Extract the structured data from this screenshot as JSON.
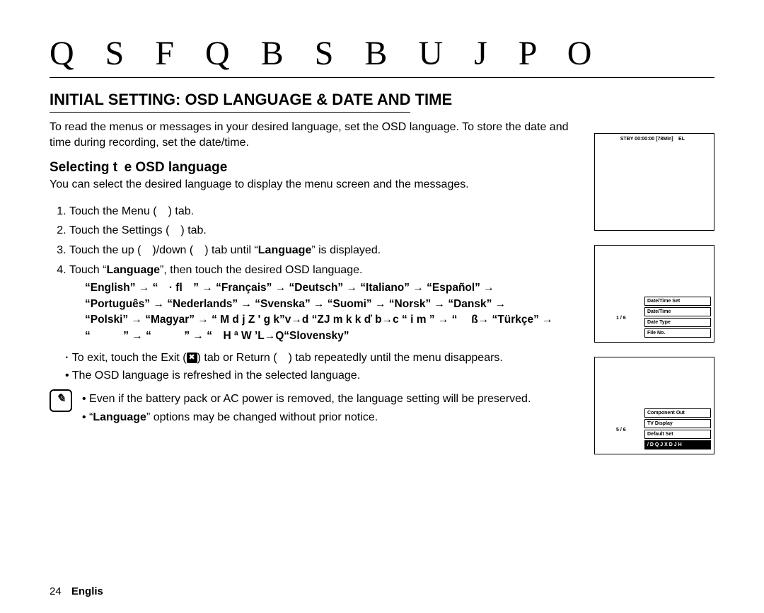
{
  "chapter_title": "Q S F Q B S B U J P O",
  "heading": "INITIAL SETTING: OSD LANGUAGE & DATE AND TIME",
  "intro": "To read the menus or messages in your desired language, set the OSD language. To store the date and time during recording, set the date/time.",
  "subheading": "Selecting t e OSD language",
  "subintro": "You can select the desired language to display the menu screen and the messages.",
  "steps": {
    "s1": "Touch the Menu (  ) tab.",
    "s2": "Touch the Settings (  ) tab.",
    "s3_pre": "Touch the up (  )/down (  ) tab until “",
    "s3_bold": "Language",
    "s3_post": "” is displayed.",
    "s4_pre": "Touch “",
    "s4_bold": "Language",
    "s4_post": "”, then touch the desired OSD language."
  },
  "lang_lines": {
    "l1": "“English” → “ · fl ” → “Français” → “Deutsch” → “Italiano” → “Español” →",
    "l2": "“Português” → “Nederlands” → “Svenska” → “Suomi” → “Norsk” → “Dansk” →",
    "l3": "“Polski” → “Magyar” → “ M d j Z ' g k”v→d “ZJ m k k ď b→c “ i m ” → “  ß→ “Türkçe” →",
    "l4": "“   ” → “   ” → “ H ª W ’L→Q“Slovensky”"
  },
  "bullets": {
    "exit_pre": "To exit, touch the Exit (",
    "exit_mid": ") tab or Return (  ) tab repeatedly until the menu disappears.",
    "exit_icon": "✖",
    "refresh": "The OSD language is refreshed in the selected language.",
    "preserve": "Even if the battery pack or AC power is removed, the language setting will be preserved.",
    "notice_pre": "“",
    "notice_bold": "Language",
    "notice_post": "” options may be changed without prior notice."
  },
  "footer": {
    "page": "24",
    "text": "Englis"
  },
  "shots": {
    "top_status": "STBY 00:00:00   [78Min]     EL  ",
    "s2": {
      "corner": "",
      "pager": "1 / 6",
      "rows": [
        "Date/Time Set",
        "Date/Time",
        "Date Type",
        "File No."
      ]
    },
    "s3": {
      "corner": "",
      "pager": "5 / 6",
      "rows": [
        "Component Out",
        "TV Display",
        "Default Set",
        "/ D Q J X D J H"
      ],
      "selected_index": 3
    }
  }
}
